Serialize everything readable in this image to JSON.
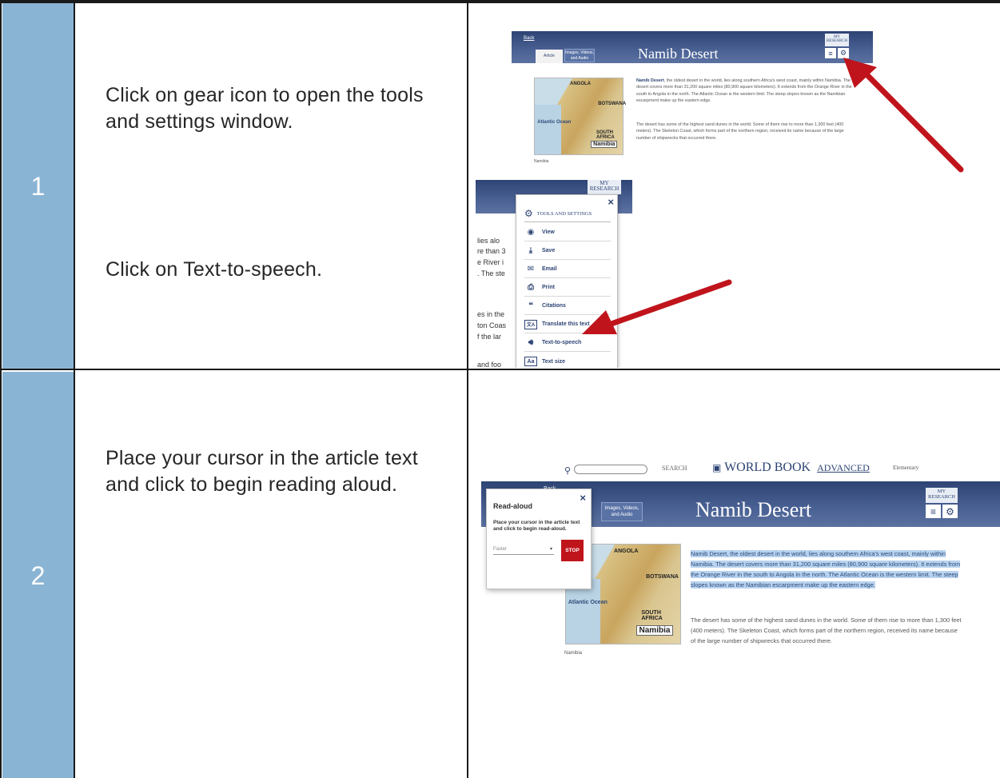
{
  "steps": [
    {
      "number": "1",
      "instruction_a": "Click on gear icon to open the tools and settings window.",
      "instruction_b": "Click on Text-to-speech."
    },
    {
      "number": "2",
      "instruction": "Place your cursor in the article text and click to begin reading aloud."
    }
  ],
  "article": {
    "back_label": "Back",
    "tab_article": "Article",
    "tab_media": "Images, Videos, and Audio",
    "title": "Namib Desert",
    "my_research": "MY RESEARCH",
    "map_caption": "Namibia",
    "map_namibia": "Namibia",
    "map_labels": {
      "angola": "ANGOLA",
      "botswana": "BOTSWANA",
      "south_africa": "SOUTH AFRICA",
      "atlantic": "Atlantic Ocean"
    },
    "p1_lead": "Namib Desert",
    "p1_rest": ", the oldest desert in the world, lies along southern Africa's west coast, mainly within Namibia. The desert covers more than 31,200 square miles (80,900 square kilometers). It extends from the Orange River in the south to Angola in the north. The Atlantic Ocean is the western limit. The steep slopes known as the Namibian escarpment make up the eastern edge.",
    "p1_full": "Namib Desert, the oldest desert in the world, lies along southern Africa's west coast, mainly within Namibia. The desert covers more than 31,200 square miles (80,900 square kilometers). It extends from the Orange River in the south to Angola in the north. The Atlantic Ocean is the western limit. The steep slopes known as the Namibian escarpment make up the eastern edge.",
    "p2": "The desert has some of the highest sand dunes in the world. Some of them rise to more than 1,300 feet (400 meters). The Skeleton Coast, which forms part of the northern region, received its name because of the large number of shipwrecks that occurred there."
  },
  "menu": {
    "my_research": "MY RESEARCH",
    "close": "×",
    "heading": "TOOLS AND SETTINGS",
    "items": [
      "View",
      "Save",
      "Email",
      "Print",
      "Citations",
      "Translate this text",
      "Text-to-speech",
      "Text size"
    ],
    "side_text": [
      "lies alo",
      "re than 3",
      "e River i",
      ". The ste",
      "es in the",
      "ton Coas",
      "f the lar",
      "and foo"
    ]
  },
  "search": {
    "button": "SEARCH",
    "brand": "WORLD BOOK",
    "brand_suffix": "ADVANCED",
    "school": "Elementary"
  },
  "readaloud": {
    "title": "Read-aloud",
    "close": "×",
    "desc": "Place your cursor in the article text and click to begin read-aloud.",
    "speed": "Faster",
    "stop": "STOP"
  },
  "colors": {
    "header_blue": "#3b5283",
    "cell_blue": "#8ab4d4",
    "arrow_red": "#c0141c",
    "highlight": "#b9d3ef"
  }
}
